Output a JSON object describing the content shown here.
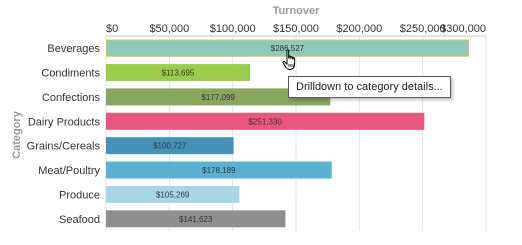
{
  "chart_data": {
    "type": "bar",
    "orientation": "horizontal",
    "categories": [
      "Beverages",
      "Condiments",
      "Confections",
      "Dairy Products",
      "Grains/Cereals",
      "Meat/Poultry",
      "Produce",
      "Seafood"
    ],
    "values": [
      286527,
      113695,
      177099,
      251330,
      100727,
      178189,
      105269,
      141623
    ],
    "value_labels": [
      "$286,527",
      "$113,695",
      "$177,099",
      "$251,330",
      "$100,727",
      "$178,189",
      "$105,269",
      "$141,623"
    ],
    "colors": [
      "#8ecabc",
      "#9acd4b",
      "#88a65e",
      "#e8577a",
      "#4592b7",
      "#5ab1d4",
      "#a7d7e6",
      "#8f8f8f"
    ],
    "xlabel": "Turnover",
    "ylabel": "Category",
    "xlim": [
      0,
      300000
    ],
    "ticks": [
      0,
      50000,
      100000,
      150000,
      200000,
      250000,
      300000
    ],
    "tick_labels": [
      "$0",
      "$50,000",
      "$100,000",
      "$150,000",
      "$200,000",
      "$250,000",
      "$300,000"
    ],
    "x_axis_position": "top",
    "grid": true,
    "highlighted_category": "Beverages",
    "highlight_color": "#e6c24a"
  },
  "tooltip": {
    "text": "Drilldown to category details..."
  },
  "cursor": {
    "icon": "hand-pointer-icon"
  }
}
